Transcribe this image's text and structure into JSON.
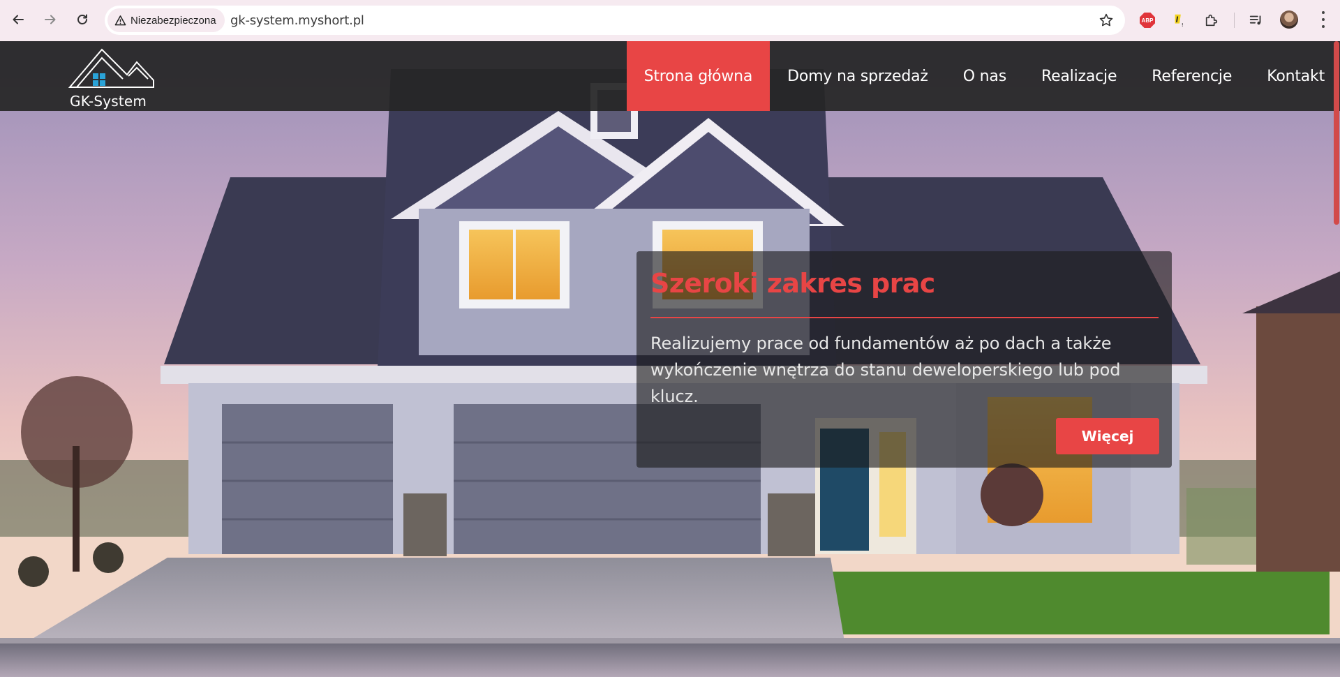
{
  "browser": {
    "security_label": "Niezabezpieczona",
    "url": "gk-system.myshort.pl",
    "extensions": [
      "adblock-plus-icon",
      "yellow-flag-extension-icon",
      "puzzle-extensions-icon",
      "media-control-icon"
    ]
  },
  "site": {
    "logo_text": "GK-System",
    "nav": [
      {
        "label": "Strona główna",
        "active": true
      },
      {
        "label": "Domy na sprzedaż",
        "active": false
      },
      {
        "label": "O nas",
        "active": false
      },
      {
        "label": "Realizacje",
        "active": false
      },
      {
        "label": "Referencje",
        "active": false
      },
      {
        "label": "Kontakt",
        "active": false
      }
    ]
  },
  "hero": {
    "title": "Szeroki zakres prac",
    "text": "Realizujemy prace od fundamentów aż po dach a także wykończenie wnętrza do stanu deweloperskiego lub pod klucz.",
    "button_label": "Więcej"
  },
  "colors": {
    "accent": "#e84545",
    "header_bg": "#262626",
    "chrome_bg": "#f6eaf0"
  }
}
